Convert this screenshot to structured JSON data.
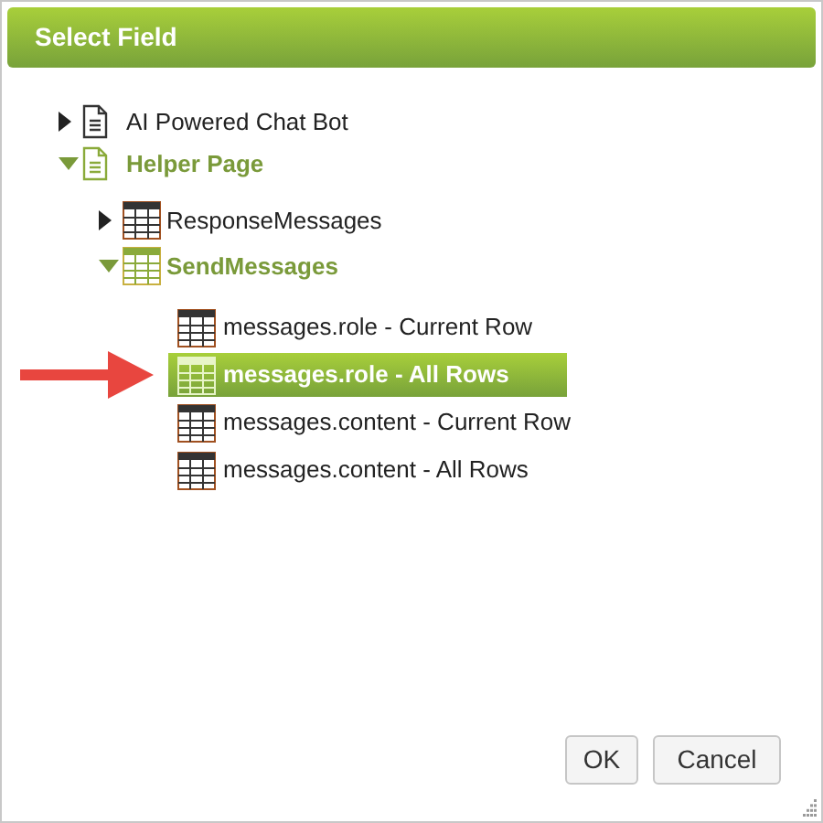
{
  "dialog": {
    "title": "Select Field"
  },
  "tree": [
    {
      "label": "AI Powered Chat Bot",
      "kind": "page",
      "expanded": false
    },
    {
      "label": "Helper Page",
      "kind": "page",
      "expanded": true,
      "children": [
        {
          "label": "ResponseMessages",
          "kind": "table",
          "expanded": false
        },
        {
          "label": "SendMessages",
          "kind": "table",
          "expanded": true,
          "children": [
            {
              "label": "messages.role - Current Row",
              "kind": "field",
              "selected": false
            },
            {
              "label": "messages.role - All Rows",
              "kind": "field",
              "selected": true
            },
            {
              "label": "messages.content - Current Row",
              "kind": "field",
              "selected": false
            },
            {
              "label": "messages.content - All Rows",
              "kind": "field",
              "selected": false
            }
          ]
        }
      ]
    }
  ],
  "buttons": [
    "OK",
    "Cancel"
  ]
}
